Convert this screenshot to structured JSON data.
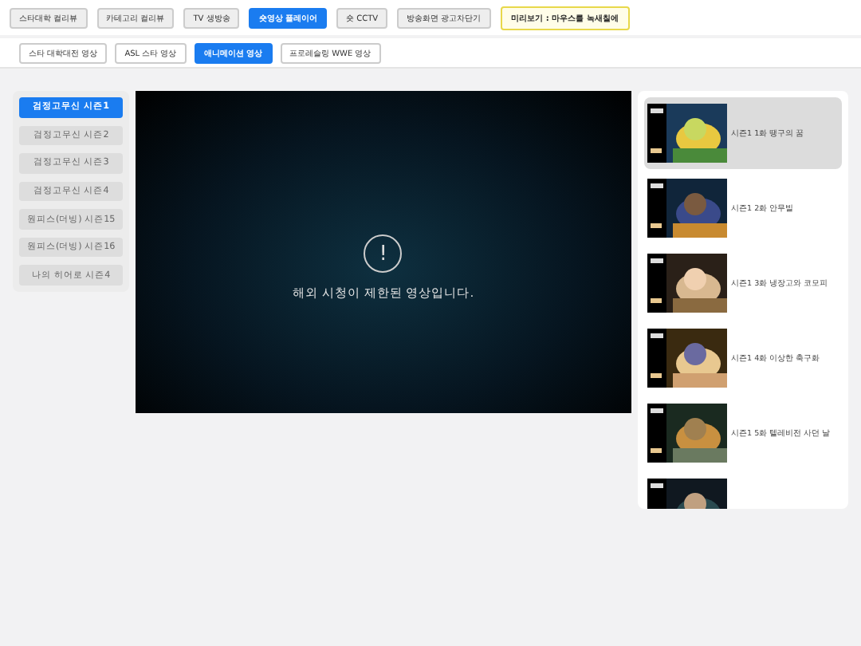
{
  "top_tabs": [
    {
      "label": "스타대학 컬리뷰",
      "selected": false
    },
    {
      "label": "카테고리 컬리뷰",
      "selected": false
    },
    {
      "label": "TV 생방송",
      "selected": false
    },
    {
      "label": "숏영상 플레이어",
      "selected": true
    },
    {
      "label": "숏 CCTV",
      "selected": false
    },
    {
      "label": "방송화면 광고차단기",
      "selected": false
    }
  ],
  "preview_note": "미리보기 : 마우스를 녹새칠에",
  "sub_tabs": [
    {
      "label": "스타 대학대전 영상",
      "selected": false
    },
    {
      "label": "ASL 스타 영상",
      "selected": false
    },
    {
      "label": "애니메이션 영상",
      "selected": true
    },
    {
      "label": "프로레슬링 WWE 영상",
      "selected": false
    }
  ],
  "seasons": [
    {
      "label": "검정고무신 시즌1",
      "selected": true
    },
    {
      "label": "검정고무신 시즌2",
      "selected": false
    },
    {
      "label": "검정고무신 시즌3",
      "selected": false
    },
    {
      "label": "검정고무신 시즌4",
      "selected": false
    },
    {
      "label": "원피스(더빙) 시즌15",
      "selected": false
    },
    {
      "label": "원피스(더빙) 시즌16",
      "selected": false
    },
    {
      "label": "나의 히어로 시즌4",
      "selected": false
    }
  ],
  "player": {
    "message": "해외 시청이 제한된 영상입니다.",
    "icon_text": "!"
  },
  "episodes": [
    {
      "title": "시즌1 1화 땡구의 꿈",
      "selected": true
    },
    {
      "title": "시즌1 2화 안무빌",
      "selected": false
    },
    {
      "title": "시즌1 3화 냉장고와 코모피",
      "selected": false
    },
    {
      "title": "시즌1 4화 이상한 축구화",
      "selected": false
    },
    {
      "title": "시즌1 5화 텔레비전 사던 날",
      "selected": false
    },
    {
      "selected": false
    }
  ]
}
